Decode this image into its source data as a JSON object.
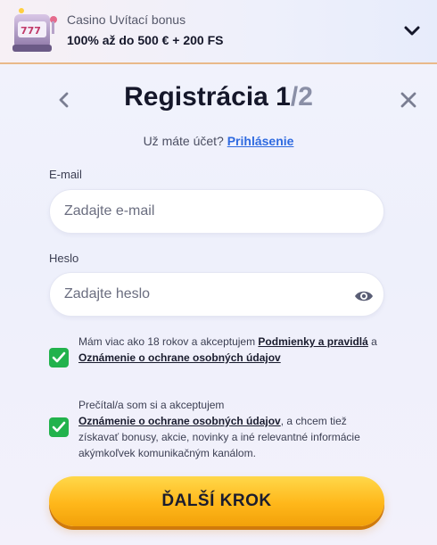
{
  "banner": {
    "title": "Casino Uvítací bonus",
    "subtitle": "100% až do 500 € + 200 FS"
  },
  "header": {
    "title_main": "Registrácia 1",
    "title_sep": "/",
    "title_total": "2"
  },
  "login": {
    "prompt": "Už máte účet?",
    "link": "Prihlásenie"
  },
  "form": {
    "email_label": "E-mail",
    "email_placeholder": "Zadajte e-mail",
    "password_label": "Heslo",
    "password_placeholder": "Zadajte heslo"
  },
  "consents": [
    {
      "checked": true,
      "text_before": "Mám viac ako 18 rokov a akceptujem ",
      "link1": "Podmienky a pravidlá",
      "middle": " a ",
      "link2": "Oznámenie o ochrane osobných údajov"
    },
    {
      "checked": true,
      "text_before": "Prečítal/a som si a akceptujem ",
      "link1": "Oznámenie o ochrane osobných údajov",
      "text_after": ", a chcem tiež získavať bonusy, akcie, novinky a iné relevantné informácie akýmkoľvek komunikačným kanálom."
    }
  ],
  "actions": {
    "next_label": "ĎALŠÍ KROK"
  },
  "colors": {
    "accent_link": "#2f6ae0",
    "checkbox": "#22b24c",
    "button": "#ffb71a"
  }
}
